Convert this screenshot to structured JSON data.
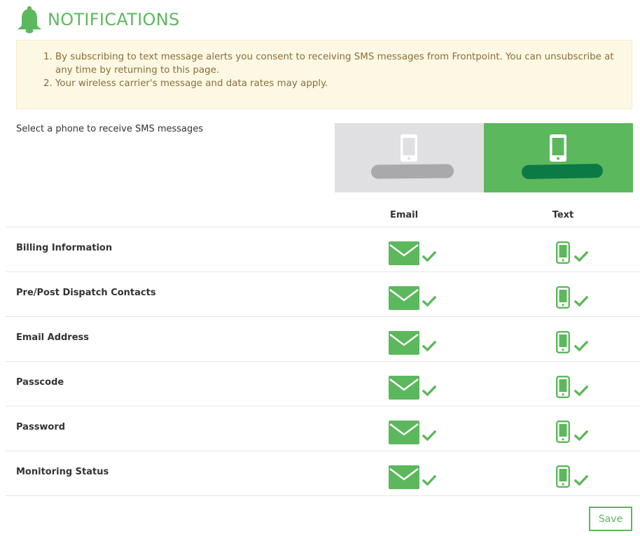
{
  "header": {
    "title": "NOTIFICATIONS",
    "icon": "bell-icon"
  },
  "alert": {
    "items": [
      "By subscribing to text message alerts you consent to receiving SMS messages from Frontpoint. You can unsubscribe at any time by returning to this page.",
      "Your wireless carrier's message and data rates may apply."
    ]
  },
  "phone_select": {
    "label": "Select a phone to receive SMS messages",
    "options": [
      {
        "icon": "smartphone-icon",
        "selected": false
      },
      {
        "icon": "smartphone-icon",
        "selected": true
      }
    ]
  },
  "columns": {
    "email": "Email",
    "text": "Text"
  },
  "rows": [
    {
      "label": "Billing Information",
      "email": true,
      "text": true
    },
    {
      "label": "Pre/Post Dispatch Contacts",
      "email": true,
      "text": true
    },
    {
      "label": "Email Address",
      "email": true,
      "text": true
    },
    {
      "label": "Passcode",
      "email": true,
      "text": true
    },
    {
      "label": "Password",
      "email": true,
      "text": true
    },
    {
      "label": "Monitoring Status",
      "email": true,
      "text": true
    }
  ],
  "save_label": "Save",
  "colors": {
    "accent": "#5cb85c",
    "accent_dark": "#0b7a45",
    "alert_bg": "#fcf8e3",
    "alert_text": "#8a6d3b",
    "tile_unselected": "#e0e0e2"
  }
}
